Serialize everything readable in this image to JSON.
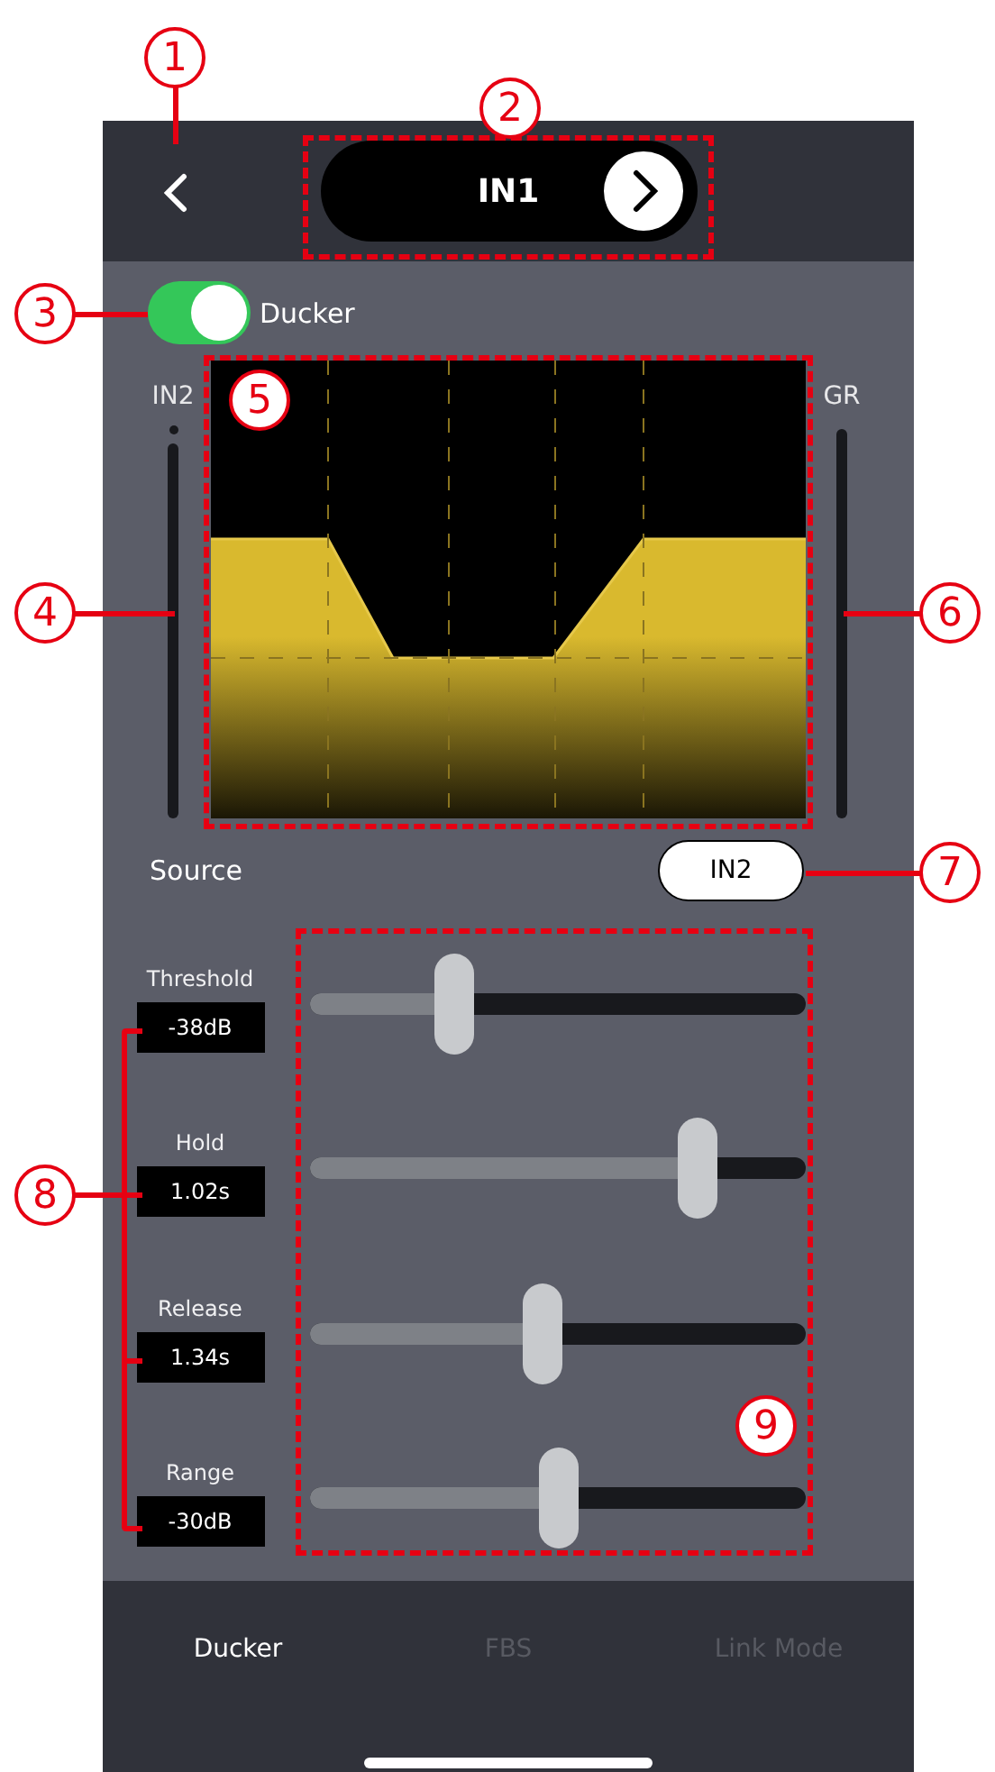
{
  "callouts": [
    {
      "label": "1"
    },
    {
      "label": "2"
    },
    {
      "label": "3"
    },
    {
      "label": "4"
    },
    {
      "label": "5"
    },
    {
      "label": "6"
    },
    {
      "label": "7"
    },
    {
      "label": "8"
    },
    {
      "label": "9"
    }
  ],
  "header": {
    "channel": "IN1"
  },
  "ducker_toggle": {
    "label": "Ducker",
    "on": true
  },
  "meters": {
    "input_label": "IN2",
    "gain_reduction_label": "GR"
  },
  "source": {
    "label": "Source",
    "value": "IN2"
  },
  "parameters": [
    {
      "name": "Threshold",
      "value": "-38dB",
      "level": 0.29
    },
    {
      "name": "Hold",
      "value": "1.02s",
      "level": 0.78
    },
    {
      "name": "Release",
      "value": "1.34s",
      "level": 0.47
    },
    {
      "name": "Range",
      "value": "-30dB",
      "level": 0.5
    }
  ],
  "tabs": [
    {
      "label": "Ducker",
      "selected": true
    },
    {
      "label": "FBS",
      "selected": false
    },
    {
      "label": "Link Mode",
      "selected": false
    }
  ]
}
